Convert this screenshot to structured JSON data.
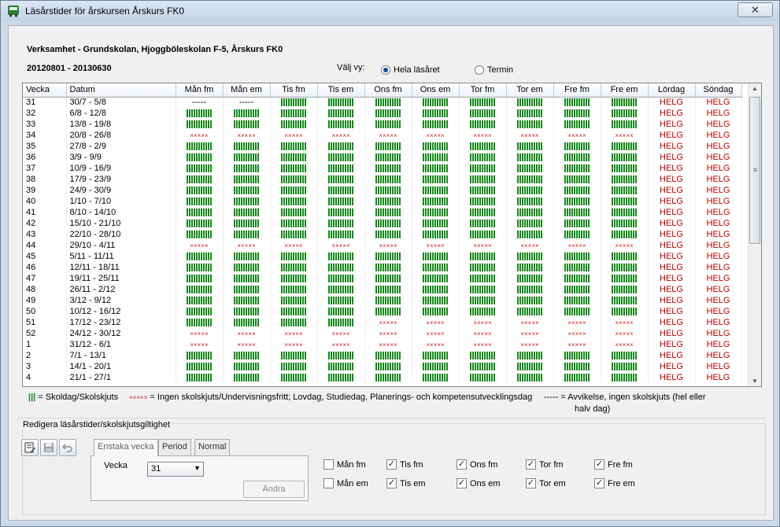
{
  "window": {
    "title": "Läsårstider för årskursen Årskurs FK0",
    "close_label": "✕"
  },
  "header": {
    "verksamhet": "Verksamhet - Grundskolan, Hjoggböleskolan F-5, Årskurs FK0",
    "period": "20120801 - 20130630",
    "valj_vy_label": "Välj vy:",
    "view_options": [
      {
        "label": "Hela läsåret",
        "selected": true
      },
      {
        "label": "Termin",
        "selected": false
      }
    ]
  },
  "grid": {
    "columns": [
      "Vecka",
      "Datum",
      "Mån fm",
      "Mån em",
      "Tis fm",
      "Tis em",
      "Ons fm",
      "Ons em",
      "Tor fm",
      "Tor em",
      "Fre fm",
      "Fre em",
      "Lördag",
      "Söndag"
    ],
    "weekend_text": "HELG",
    "rows": [
      {
        "vecka": "31",
        "datum": "30/7 - 5/8",
        "cells": [
          "dash",
          "dash",
          "bar",
          "bar",
          "bar",
          "bar",
          "bar",
          "bar",
          "bar",
          "bar"
        ]
      },
      {
        "vecka": "32",
        "datum": "6/8 - 12/8",
        "cells": [
          "bar",
          "bar",
          "bar",
          "bar",
          "bar",
          "bar",
          "bar",
          "bar",
          "bar",
          "bar"
        ]
      },
      {
        "vecka": "33",
        "datum": "13/8 - 19/8",
        "cells": [
          "bar",
          "bar",
          "bar",
          "bar",
          "bar",
          "bar",
          "bar",
          "bar",
          "bar",
          "bar"
        ]
      },
      {
        "vecka": "34",
        "datum": "20/8 - 26/8",
        "cells": [
          "cross",
          "cross",
          "cross",
          "cross",
          "cross",
          "cross",
          "cross",
          "cross",
          "cross",
          "cross"
        ]
      },
      {
        "vecka": "35",
        "datum": "27/8 - 2/9",
        "cells": [
          "bar",
          "bar",
          "bar",
          "bar",
          "bar",
          "bar",
          "bar",
          "bar",
          "bar",
          "bar"
        ]
      },
      {
        "vecka": "36",
        "datum": "3/9 - 9/9",
        "cells": [
          "bar",
          "bar",
          "bar",
          "bar",
          "bar",
          "bar",
          "bar",
          "bar",
          "bar",
          "bar"
        ]
      },
      {
        "vecka": "37",
        "datum": "10/9 - 16/9",
        "cells": [
          "bar",
          "bar",
          "bar",
          "bar",
          "bar",
          "bar",
          "bar",
          "bar",
          "bar",
          "bar"
        ]
      },
      {
        "vecka": "38",
        "datum": "17/9 - 23/9",
        "cells": [
          "bar",
          "bar",
          "bar",
          "bar",
          "bar",
          "bar",
          "bar",
          "bar",
          "bar",
          "bar"
        ]
      },
      {
        "vecka": "39",
        "datum": "24/9 - 30/9",
        "cells": [
          "bar",
          "bar",
          "bar",
          "bar",
          "bar",
          "bar",
          "bar",
          "bar",
          "bar",
          "bar"
        ]
      },
      {
        "vecka": "40",
        "datum": "1/10 - 7/10",
        "cells": [
          "bar",
          "bar",
          "bar",
          "bar",
          "bar",
          "bar",
          "bar",
          "bar",
          "bar",
          "bar"
        ]
      },
      {
        "vecka": "41",
        "datum": "8/10 - 14/10",
        "cells": [
          "bar",
          "bar",
          "bar",
          "bar",
          "bar",
          "bar",
          "bar",
          "bar",
          "bar",
          "bar"
        ]
      },
      {
        "vecka": "42",
        "datum": "15/10 - 21/10",
        "cells": [
          "bar",
          "bar",
          "bar",
          "bar",
          "bar",
          "bar",
          "bar",
          "bar",
          "bar",
          "bar"
        ]
      },
      {
        "vecka": "43",
        "datum": "22/10 - 28/10",
        "cells": [
          "bar",
          "bar",
          "bar",
          "bar",
          "bar",
          "bar",
          "bar",
          "bar",
          "bar",
          "bar"
        ]
      },
      {
        "vecka": "44",
        "datum": "29/10 - 4/11",
        "cells": [
          "cross",
          "cross",
          "cross",
          "cross",
          "cross",
          "cross",
          "cross",
          "cross",
          "cross",
          "cross"
        ]
      },
      {
        "vecka": "45",
        "datum": "5/11 - 11/11",
        "cells": [
          "bar",
          "bar",
          "bar",
          "bar",
          "bar",
          "bar",
          "bar",
          "bar",
          "bar",
          "bar"
        ]
      },
      {
        "vecka": "46",
        "datum": "12/11 - 18/11",
        "cells": [
          "bar",
          "bar",
          "bar",
          "bar",
          "bar",
          "bar",
          "bar",
          "bar",
          "bar",
          "bar"
        ]
      },
      {
        "vecka": "47",
        "datum": "19/11 - 25/11",
        "cells": [
          "bar",
          "bar",
          "bar",
          "bar",
          "bar",
          "bar",
          "bar",
          "bar",
          "bar",
          "bar"
        ]
      },
      {
        "vecka": "48",
        "datum": "26/11 - 2/12",
        "cells": [
          "bar",
          "bar",
          "bar",
          "bar",
          "bar",
          "bar",
          "bar",
          "bar",
          "bar",
          "bar"
        ]
      },
      {
        "vecka": "49",
        "datum": "3/12 - 9/12",
        "cells": [
          "bar",
          "bar",
          "bar",
          "bar",
          "bar",
          "bar",
          "bar",
          "bar",
          "bar",
          "bar"
        ]
      },
      {
        "vecka": "50",
        "datum": "10/12 - 16/12",
        "cells": [
          "bar",
          "bar",
          "bar",
          "bar",
          "bar",
          "bar",
          "bar",
          "bar",
          "bar",
          "bar"
        ]
      },
      {
        "vecka": "51",
        "datum": "17/12 - 23/12",
        "cells": [
          "bar",
          "bar",
          "bar",
          "bar",
          "cross",
          "cross",
          "cross",
          "cross",
          "cross",
          "cross"
        ]
      },
      {
        "vecka": "52",
        "datum": "24/12 - 30/12",
        "cells": [
          "cross",
          "cross",
          "cross",
          "cross",
          "cross",
          "cross",
          "cross",
          "cross",
          "cross",
          "cross"
        ]
      },
      {
        "vecka": "1",
        "datum": "31/12 - 6/1",
        "cells": [
          "cross",
          "cross",
          "cross",
          "cross",
          "cross",
          "cross",
          "cross",
          "cross",
          "cross",
          "cross"
        ]
      },
      {
        "vecka": "2",
        "datum": "7/1 - 13/1",
        "cells": [
          "bar",
          "bar",
          "bar",
          "bar",
          "bar",
          "bar",
          "bar",
          "bar",
          "bar",
          "bar"
        ]
      },
      {
        "vecka": "3",
        "datum": "14/1 - 20/1",
        "cells": [
          "bar",
          "bar",
          "bar",
          "bar",
          "bar",
          "bar",
          "bar",
          "bar",
          "bar",
          "bar"
        ]
      },
      {
        "vecka": "4",
        "datum": "21/1 - 27/1",
        "cells": [
          "bar",
          "bar",
          "bar",
          "bar",
          "bar",
          "bar",
          "bar",
          "bar",
          "bar",
          "bar"
        ]
      }
    ]
  },
  "cell_symbols": {
    "dash": "-----",
    "cross": "×××××"
  },
  "legend": {
    "skoldag": "= Skoldag/Skolskjuts",
    "ingen_mark": "×××××",
    "ingen": "=  Ingen skolskjuts/Undervisningsfritt; Lovdag, Studiedag, Planerings- och kompetensutvecklingsdag",
    "avvikelse_mark": "-----",
    "avvikelse_line1": "=   Avvikelse, ingen skolskjuts (hel eller",
    "avvikelse_line2": "halv dag)"
  },
  "edit": {
    "group_title": "Redigera läsårstider/skolskjutsgiltighet",
    "tools": [
      "edit-icon",
      "save-icon",
      "undo-icon"
    ],
    "tabs": [
      "Enstaka vecka",
      "Period",
      "Normal"
    ],
    "vecka_label": "Vecka",
    "vecka_value": "31",
    "andra_label": "Ändra",
    "checkboxes": [
      {
        "label": "Mån fm",
        "checked": false
      },
      {
        "label": "Tis fm",
        "checked": true
      },
      {
        "label": "Ons fm",
        "checked": true
      },
      {
        "label": "Tor fm",
        "checked": true
      },
      {
        "label": "Fre fm",
        "checked": true
      },
      {
        "label": "Mån em",
        "checked": false
      },
      {
        "label": "Tis em",
        "checked": true
      },
      {
        "label": "Ons em",
        "checked": true
      },
      {
        "label": "Tor em",
        "checked": true
      },
      {
        "label": "Fre em",
        "checked": true
      }
    ]
  },
  "colors": {
    "school_day": "#18881c",
    "no_school": "#d02020",
    "weekend": "#c00000"
  }
}
